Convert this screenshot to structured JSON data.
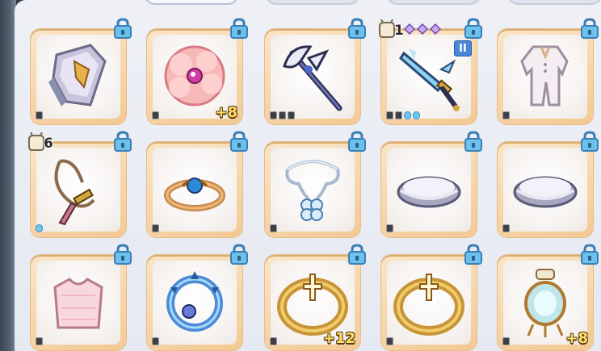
{
  "inventory": {
    "items": [
      {
        "id": "r1c1",
        "icon": "crystal-shield-icon",
        "refine": "",
        "dots": [
          "dark"
        ],
        "locked": true
      },
      {
        "id": "r1c2",
        "icon": "pink-flower-hat-icon",
        "refine": "+8",
        "dots": [
          "dark"
        ],
        "locked": true
      },
      {
        "id": "r1c3",
        "icon": "halberd-weapon-icon",
        "refine": "",
        "dots": [
          "dark",
          "dark",
          "dark"
        ],
        "locked": true
      },
      {
        "id": "r1c4",
        "icon": "crystal-sword-icon",
        "refine": "",
        "dots": [
          "dark",
          "dark",
          "blue",
          "blue"
        ],
        "locked": true,
        "bag_count": "1",
        "diamond_count": 3,
        "roman": "II"
      },
      {
        "id": "r1c5",
        "icon": "white-suit-armor-icon",
        "refine": "",
        "dots": [
          "dark"
        ],
        "locked": true
      },
      {
        "id": "r2c1",
        "icon": "dagger-amulet-icon",
        "refine": "",
        "dots": [
          "blue"
        ],
        "locked": true,
        "bag_count": "6"
      },
      {
        "id": "r2c2",
        "icon": "gem-ring-icon",
        "refine": "",
        "dots": [
          "dark"
        ],
        "locked": true
      },
      {
        "id": "r2c3",
        "icon": "clover-necklace-icon",
        "refine": "",
        "dots": [
          "dark"
        ],
        "locked": true
      },
      {
        "id": "r2c4",
        "icon": "silver-bracelet-icon",
        "refine": "",
        "dots": [
          "dark"
        ],
        "locked": true
      },
      {
        "id": "r2c5",
        "icon": "silver-bracelet-icon",
        "refine": "",
        "dots": [
          "dark"
        ],
        "locked": true
      },
      {
        "id": "r3c1",
        "icon": "pink-garment-icon",
        "refine": "",
        "dots": [
          "dark"
        ],
        "locked": true
      },
      {
        "id": "r3c2",
        "icon": "blue-spiked-ring-icon",
        "refine": "",
        "dots": [
          "dark"
        ],
        "locked": true
      },
      {
        "id": "r3c3",
        "icon": "gold-cross-ring-icon",
        "refine": "+12",
        "dots": [
          "dark"
        ],
        "locked": true
      },
      {
        "id": "r3c4",
        "icon": "gold-cross-ring-icon",
        "refine": "",
        "dots": [
          "dark"
        ],
        "locked": true
      },
      {
        "id": "r3c5",
        "icon": "lantern-charm-icon",
        "refine": "+8",
        "dots": [
          "dark"
        ],
        "locked": true
      }
    ]
  },
  "colors": {
    "slot_border": "#f3c994",
    "lock_blue": "#5fb6e6",
    "refine_text": "#ffe066"
  }
}
